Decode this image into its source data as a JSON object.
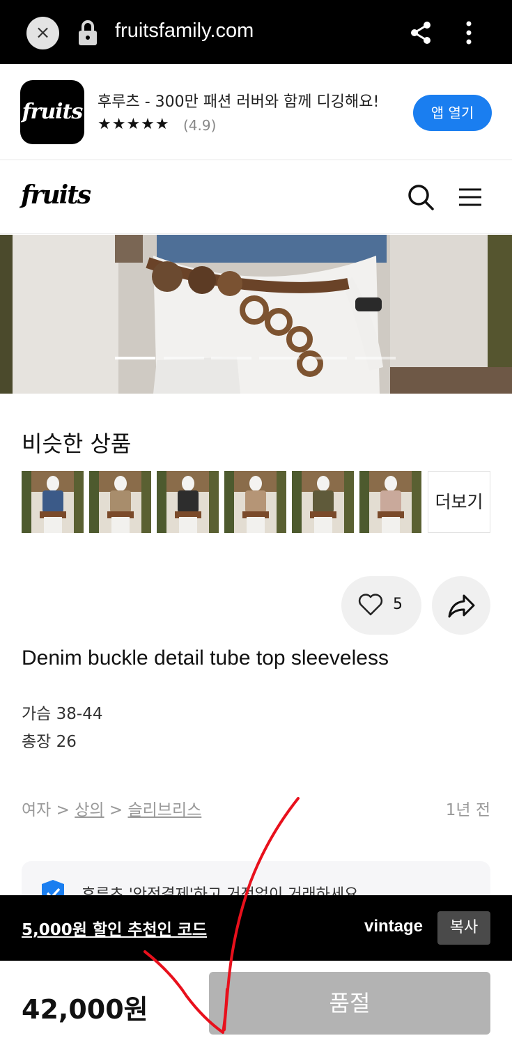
{
  "browser": {
    "url": "fruitsfamily.com",
    "close_icon": "×"
  },
  "app_banner": {
    "logo_text": "fruits",
    "title": "후루츠 - 300만 패션 러버와 함께 디깅해요!",
    "stars": "★★★★★",
    "rating": "(4.9)",
    "open_button": "앱 열기"
  },
  "header": {
    "logo": "fruits"
  },
  "gallery": {
    "page_count": 6,
    "active_index": 0
  },
  "similar": {
    "title": "비슷한 상품",
    "more_label": "더보기",
    "thumbnails": [
      {
        "name": "thumb-blue-top",
        "color": "#3b5a88"
      },
      {
        "name": "thumb-beige-vest",
        "color": "#a88d6c"
      },
      {
        "name": "thumb-black-top",
        "color": "#2d2d2d"
      },
      {
        "name": "thumb-tan-top",
        "color": "#b59576"
      },
      {
        "name": "thumb-camo-top",
        "color": "#5f5a3a"
      },
      {
        "name": "thumb-pink-top",
        "color": "#c9a99b"
      }
    ]
  },
  "actions": {
    "like_count": "5"
  },
  "product": {
    "name": "Denim buckle detail tube top sleeveless",
    "desc": [
      "가슴 38-44",
      "총장 26"
    ],
    "breadcrumb": {
      "root": "여자",
      "sep": " > ",
      "category": "상의",
      "subcategory": "슬리브리스"
    },
    "posted": "1년 전"
  },
  "safe_payment": {
    "text": "후루츠 '안전결제'하고 거정없이 거래하세요"
  },
  "promo": {
    "link_text": "5,000원 할인 추천인 코드",
    "code": "vintage",
    "copy_label": "복사"
  },
  "purchase": {
    "price": "42,000원",
    "status_button": "품절"
  },
  "colors": {
    "accent_blue": "#1a7ef0",
    "annotation_red": "#e8101c",
    "soldout_gray": "#b3b3b3"
  }
}
